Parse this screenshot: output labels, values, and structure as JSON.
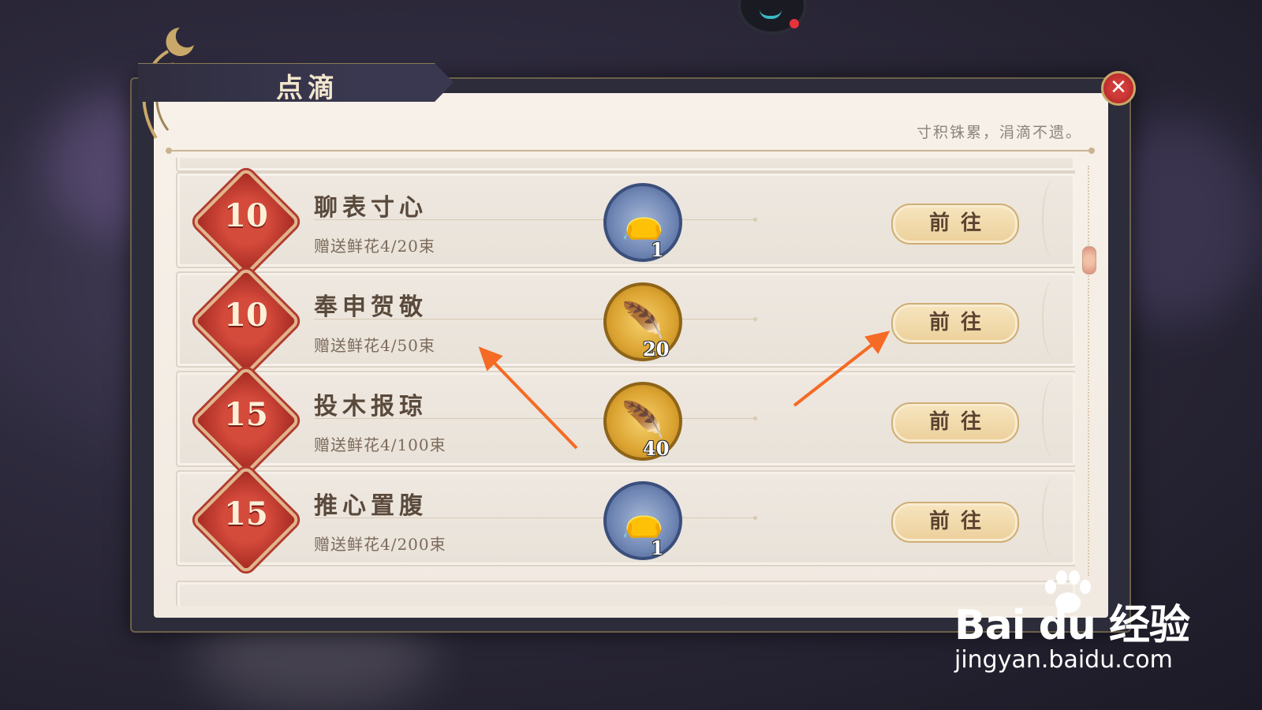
{
  "dialog": {
    "title": "点滴",
    "close_label": "✕",
    "motto": "寸积铢累，涓滴不遗。"
  },
  "items": [
    {
      "badge": "10",
      "title": "聊表寸心",
      "subtitle": "赠送鲜花4/20束",
      "reward_icon": "flower-bag-icon",
      "reward_count": "1",
      "button": "前往"
    },
    {
      "badge": "10",
      "title": "奉申贺敬",
      "subtitle": "赠送鲜花4/50束",
      "reward_icon": "gold-feather-icon",
      "reward_count": "20",
      "button": "前往"
    },
    {
      "badge": "15",
      "title": "投木报琼",
      "subtitle": "赠送鲜花4/100束",
      "reward_icon": "gold-feather-icon",
      "reward_count": "40",
      "button": "前往"
    },
    {
      "badge": "15",
      "title": "推心置腹",
      "subtitle": "赠送鲜花4/200束",
      "reward_icon": "flower-bag-icon",
      "reward_count": "1",
      "button": "前往"
    }
  ],
  "watermark": {
    "brand": "Bai du 经验",
    "url": "jingyan.baidu.com"
  },
  "colors": {
    "accent_red": "#d44a3b",
    "button_gold": "#ecd09b",
    "annotation_arrow": "#f56a24"
  }
}
